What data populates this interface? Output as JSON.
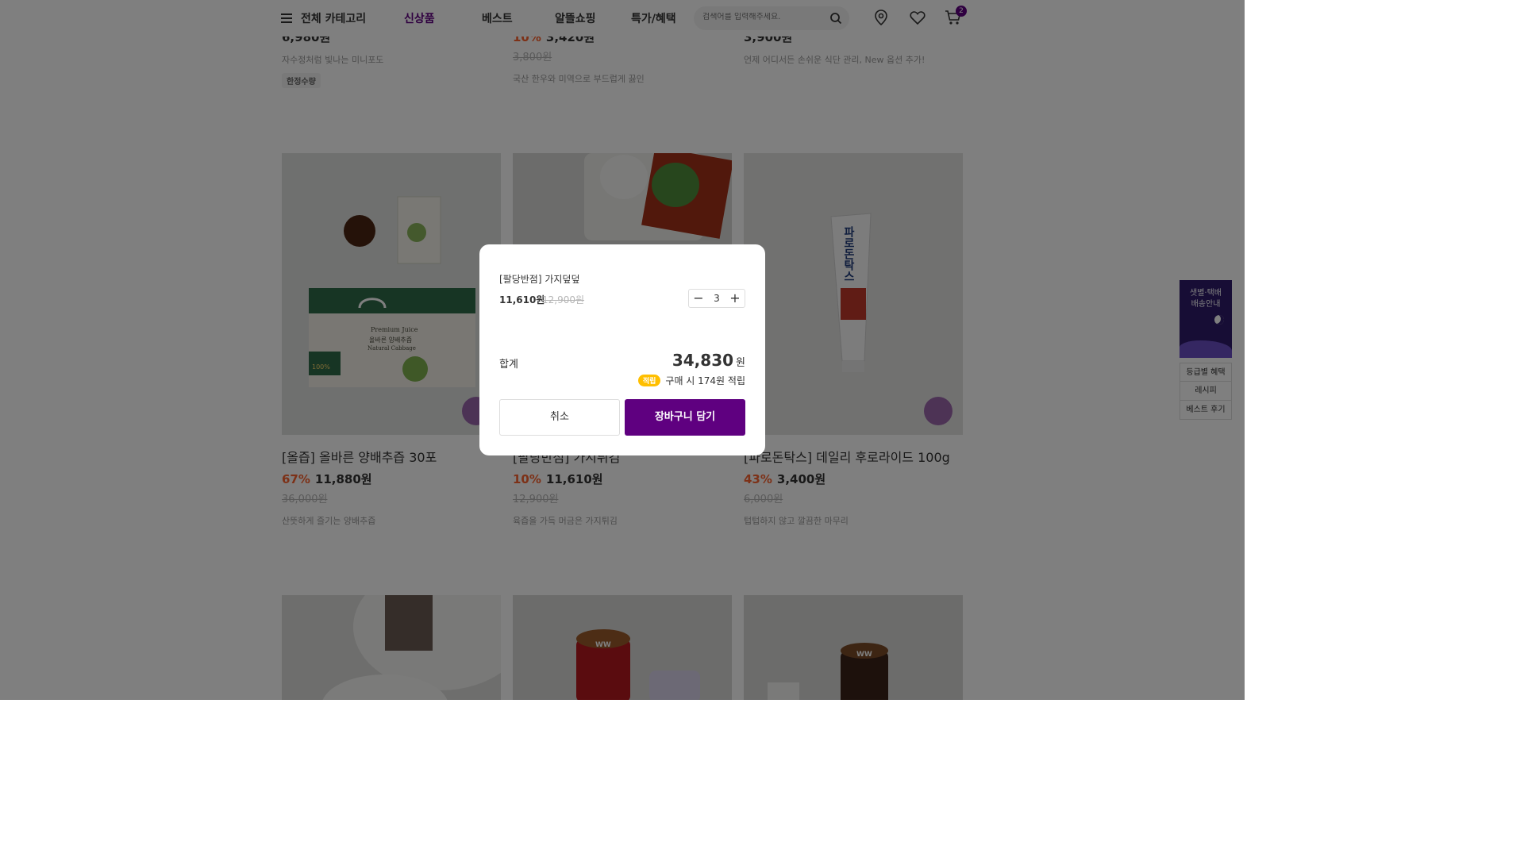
{
  "header": {
    "category_label": "전체 카테고리",
    "nav": [
      "신상품",
      "베스트",
      "알뜰쇼핑",
      "특가/혜택"
    ],
    "active_nav": "신상품",
    "search_placeholder": "검색어를 입력해주세요.",
    "cart_count": "2"
  },
  "top_row": [
    {
      "price_partial": "6,980원",
      "desc": "자수정처럼 빛나는 미니포도",
      "tag": "한정수량"
    },
    {
      "discount": "10%",
      "price_partial": "3,420원",
      "original": "3,800원",
      "desc": "국산 한우와 미역으로 부드럽게 끓인"
    },
    {
      "price_partial": "3,900원",
      "desc": "언제 어디서든 손쉬운 식단 관리, New 옵션 추가!"
    }
  ],
  "products": [
    {
      "name": "[올즙] 올바른 양배추즙 30포",
      "discount": "67%",
      "price": "11,880원",
      "original": "36,000원",
      "desc": "산뜻하게 즐기는 양배추즙"
    },
    {
      "name": "[팔당반점] 가지튀김",
      "discount": "10%",
      "price": "11,610원",
      "original": "12,900원",
      "desc": "육즙을 가득 머금은 가지튀김"
    },
    {
      "name": "[파로돈탁스] 데일리 후로라이드 100g",
      "discount": "43%",
      "price": "3,400원",
      "original": "6,000원",
      "desc": "텁텁하지 않고 깔끔한 마무리"
    }
  ],
  "product_images": {
    "juice_box_title": "Premium Juice",
    "juice_box_kr": "올바른 양배추즙",
    "juice_box_en": "Natural Cabbage",
    "juice_badge": "100%",
    "toothpaste_text": "파로돈탁스",
    "candle_text": "WW"
  },
  "sidebar": {
    "banner_text": "샛별·택배\n배송안내",
    "items": [
      "등급별 혜택",
      "레시피",
      "베스트 후기"
    ]
  },
  "modal": {
    "product_name": "[팔당반점] 가지덮덮",
    "price": "11,610원",
    "original_price": "12,900원",
    "quantity": "3",
    "minus": "−",
    "plus": "+",
    "total_label": "합계",
    "total_value": "34,830",
    "total_unit": "원",
    "point_badge": "적립",
    "point_text": "구매 시 174원 적립",
    "cancel_label": "취소",
    "add_label": "장바구니 담기"
  },
  "colors": {
    "brand": "#5f0080",
    "discount": "#fa622f",
    "point": "#ffbf00"
  }
}
